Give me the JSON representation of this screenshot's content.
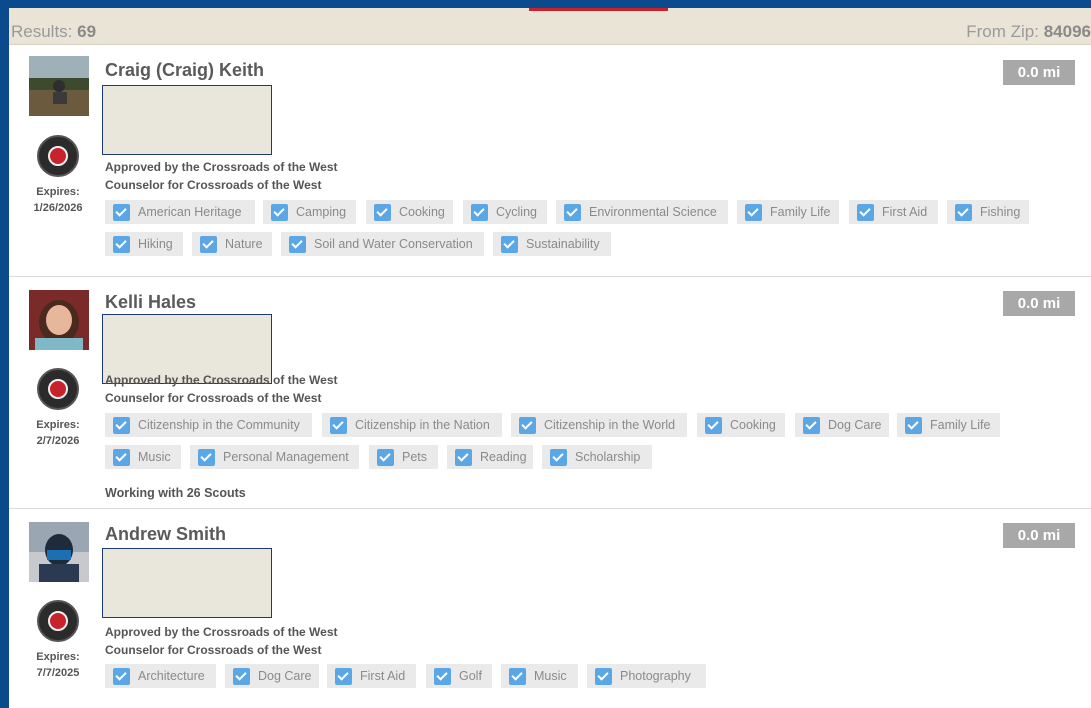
{
  "header": {
    "results_label": "Results:",
    "results_count": "69",
    "zip_label": "From Zip:",
    "zip_value": "84096"
  },
  "colors": {
    "accent": "#c8232c",
    "chip_check": "#5ba7e5",
    "distance_badge": "#a8a8a8",
    "frame_border": "#0b4a8c"
  },
  "counselors": [
    {
      "name": "Craig (Craig) Keith",
      "distance": "0.0 mi",
      "expires_label": "Expires:",
      "expires_date": "1/26/2026",
      "approved": "Approved by the Crossroads of the West",
      "counselor_for": "Counselor for Crossroads of the West",
      "badges": [
        "American Heritage",
        "Camping",
        "Cooking",
        "Cycling",
        "Environmental Science",
        "Family Life",
        "First Aid",
        "Fishing",
        "Hiking",
        "Nature",
        "Soil and Water Conservation",
        "Sustainability"
      ],
      "working_with": ""
    },
    {
      "name": "Kelli Hales",
      "distance": "0.0 mi",
      "expires_label": "Expires:",
      "expires_date": "2/7/2026",
      "approved": "Approved by the Crossroads of the West",
      "counselor_for": "Counselor for Crossroads of the West",
      "badges": [
        "Citizenship in the Community",
        "Citizenship in the Nation",
        "Citizenship in the World",
        "Cooking",
        "Dog Care",
        "Family Life",
        "Music",
        "Personal Management",
        "Pets",
        "Reading",
        "Scholarship"
      ],
      "working_with": "Working with 26 Scouts"
    },
    {
      "name": "Andrew Smith",
      "distance": "0.0 mi",
      "expires_label": "Expires:",
      "expires_date": "7/7/2025",
      "approved": "Approved by the Crossroads of the West",
      "counselor_for": "Counselor for Crossroads of the West",
      "badges": [
        "Architecture",
        "Dog Care",
        "First Aid",
        "Golf",
        "Music",
        "Photography"
      ],
      "working_with": ""
    }
  ]
}
